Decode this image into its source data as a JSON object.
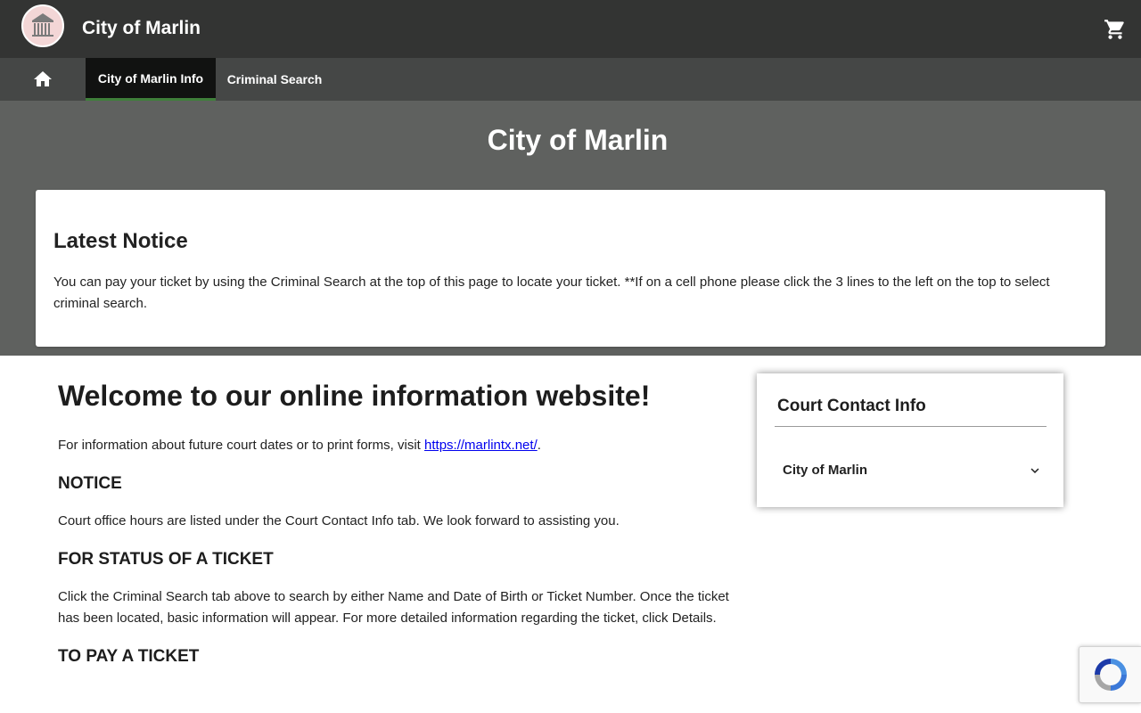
{
  "header": {
    "app_title": "City of Marlin",
    "logo_icon": "courthouse-icon",
    "cart_icon": "cart-icon"
  },
  "nav": {
    "home_icon": "home-icon",
    "tabs": [
      {
        "label": "City of Marlin Info",
        "active": true
      },
      {
        "label": "Criminal Search",
        "active": false
      }
    ]
  },
  "hero": {
    "title": "City of Marlin"
  },
  "notice": {
    "heading": "Latest Notice",
    "text": "You can pay your ticket by using the Criminal Search at the top of this page to locate your ticket. **If on a cell phone please click the 3 lines to the left on the top to select criminal search."
  },
  "main": {
    "welcome": "Welcome to our online information website!",
    "intro_prefix": "For information about future court dates or to print forms, visit ",
    "intro_link": "https://marlintx.net/",
    "intro_suffix": ".",
    "sections": [
      {
        "heading": "NOTICE",
        "text": "Court office hours are listed under the Court Contact Info tab. We look forward to assisting you."
      },
      {
        "heading": "FOR STATUS OF A TICKET",
        "text": "Click the Criminal Search tab above to search by either Name and Date of Birth or Ticket Number. Once the ticket has been located, basic information will appear. For more detailed information regarding the ticket, click Details."
      },
      {
        "heading": "TO PAY A TICKET",
        "text": ""
      }
    ]
  },
  "contact": {
    "title": "Court Contact Info",
    "item_label": "City of Marlin",
    "item_icon": "chevron-down-icon"
  },
  "colors": {
    "topbar": "#333433",
    "navbar": "#454746",
    "hero": "#5f615f",
    "active_tab_indicator": "#3f7f3a",
    "link": "#0000ee"
  }
}
